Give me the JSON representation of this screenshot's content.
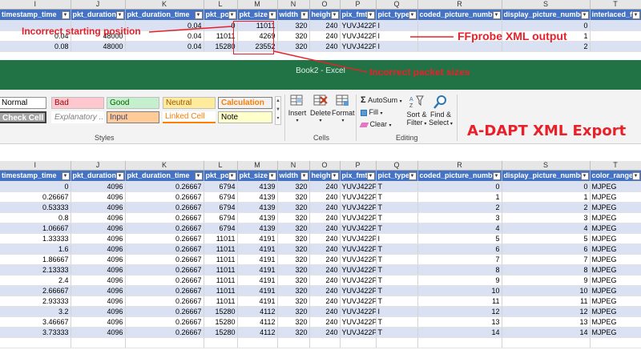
{
  "column_letters": [
    "I",
    "J",
    "K",
    "L",
    "M",
    "N",
    "O",
    "P",
    "Q",
    "R",
    "S",
    "T"
  ],
  "top_sheet": {
    "headers": [
      "timestamp_time",
      "pkt_duration",
      "pkt_duration_time",
      "pkt_pos",
      "pkt_size",
      "width",
      "height",
      "pix_fmt",
      "pict_type",
      "coded_picture_number",
      "display_picture_number",
      "interlaced_f"
    ],
    "rows": [
      [
        "",
        "",
        "0.04",
        "0",
        "11011",
        "320",
        "240",
        "YUVJ422P",
        "I",
        "",
        "0",
        ""
      ],
      [
        "0.04",
        "48000",
        "0.04",
        "11011",
        "4269",
        "320",
        "240",
        "YUVJ422P",
        "I",
        "",
        "1",
        ""
      ],
      [
        "0.08",
        "48000",
        "0.04",
        "15280",
        "23552",
        "320",
        "240",
        "YUVJ422P",
        "I",
        "",
        "2",
        ""
      ]
    ]
  },
  "excel": {
    "title": "Book2 - Excel",
    "styles": {
      "normal": "Normal",
      "bad": "Bad",
      "good": "Good",
      "neutral": "Neutral",
      "calculation": "Calculation",
      "check_cell": "Check Cell",
      "explanatory": "Explanatory ...",
      "input": "Input",
      "linked_cell": "Linked Cell",
      "note": "Note",
      "group_label": "Styles"
    },
    "cells": {
      "insert": "Insert",
      "delete": "Delete",
      "format": "Format",
      "group_label": "Cells"
    },
    "editing": {
      "autosum": "AutoSum",
      "fill": "Fill",
      "clear": "Clear",
      "sort_filter_1": "Sort &",
      "sort_filter_2": "Filter",
      "find_select_1": "Find &",
      "find_select_2": "Select",
      "group_label": "Editing"
    }
  },
  "bottom_sheet": {
    "headers": [
      "timestamp_time",
      "pkt_duration",
      "pkt_duration_time",
      "pkt_pos",
      "pkt_size",
      "width",
      "height",
      "pix_fmt",
      "pict_type",
      "coded_picture_number",
      "display_picture_number",
      "color_range"
    ],
    "rows": [
      [
        "0",
        "4096",
        "0.26667",
        "6794",
        "4139",
        "320",
        "240",
        "YUVJ422P",
        "T",
        "0",
        "0",
        "MJPEG"
      ],
      [
        "0.26667",
        "4096",
        "0.26667",
        "6794",
        "4139",
        "320",
        "240",
        "YUVJ422P",
        "T",
        "1",
        "1",
        "MJPEG"
      ],
      [
        "0.53333",
        "4096",
        "0.26667",
        "6794",
        "4139",
        "320",
        "240",
        "YUVJ422P",
        "T",
        "2",
        "2",
        "MJPEG"
      ],
      [
        "0.8",
        "4096",
        "0.26667",
        "6794",
        "4139",
        "320",
        "240",
        "YUVJ422P",
        "T",
        "3",
        "3",
        "MJPEG"
      ],
      [
        "1.06667",
        "4096",
        "0.26667",
        "6794",
        "4139",
        "320",
        "240",
        "YUVJ422P",
        "T",
        "4",
        "4",
        "MJPEG"
      ],
      [
        "1.33333",
        "4096",
        "0.26667",
        "11011",
        "4191",
        "320",
        "240",
        "YUVJ422P",
        "I",
        "5",
        "5",
        "MJPEG"
      ],
      [
        "1.6",
        "4096",
        "0.26667",
        "11011",
        "4191",
        "320",
        "240",
        "YUVJ422P",
        "T",
        "6",
        "6",
        "MJPEG"
      ],
      [
        "1.86667",
        "4096",
        "0.26667",
        "11011",
        "4191",
        "320",
        "240",
        "YUVJ422P",
        "T",
        "7",
        "7",
        "MJPEG"
      ],
      [
        "2.13333",
        "4096",
        "0.26667",
        "11011",
        "4191",
        "320",
        "240",
        "YUVJ422P",
        "T",
        "8",
        "8",
        "MJPEG"
      ],
      [
        "2.4",
        "4096",
        "0.26667",
        "11011",
        "4191",
        "320",
        "240",
        "YUVJ422P",
        "T",
        "9",
        "9",
        "MJPEG"
      ],
      [
        "2.66667",
        "4096",
        "0.26667",
        "11011",
        "4191",
        "320",
        "240",
        "YUVJ422P",
        "T",
        "10",
        "10",
        "MJPEG"
      ],
      [
        "2.93333",
        "4096",
        "0.26667",
        "11011",
        "4191",
        "320",
        "240",
        "YUVJ422P",
        "T",
        "11",
        "11",
        "MJPEG"
      ],
      [
        "3.2",
        "4096",
        "0.26667",
        "15280",
        "4112",
        "320",
        "240",
        "YUVJ422P",
        "I",
        "12",
        "12",
        "MJPEG"
      ],
      [
        "3.46667",
        "4096",
        "0.26667",
        "15280",
        "4112",
        "320",
        "240",
        "YUVJ422P",
        "T",
        "13",
        "13",
        "MJPEG"
      ],
      [
        "3.73333",
        "4096",
        "0.26667",
        "15280",
        "4112",
        "320",
        "240",
        "YUVJ422P",
        "T",
        "14",
        "14",
        "MJPEG"
      ],
      [
        "",
        "",
        "",
        "",
        "",
        "",
        "",
        "",
        "",
        "",
        "",
        ""
      ]
    ]
  },
  "annotations": {
    "incorrect_start": "Incorrect starting position",
    "ffprobe": "FFprobe XML output",
    "incorrect_sizes": "Incorrect packet sizes",
    "adapt": "A-DAPT XML Export",
    "color": "#e8202a"
  },
  "colors": {
    "header_blue": "#4472c4",
    "band_blue": "#d9e1f2",
    "excel_green": "#217346"
  }
}
